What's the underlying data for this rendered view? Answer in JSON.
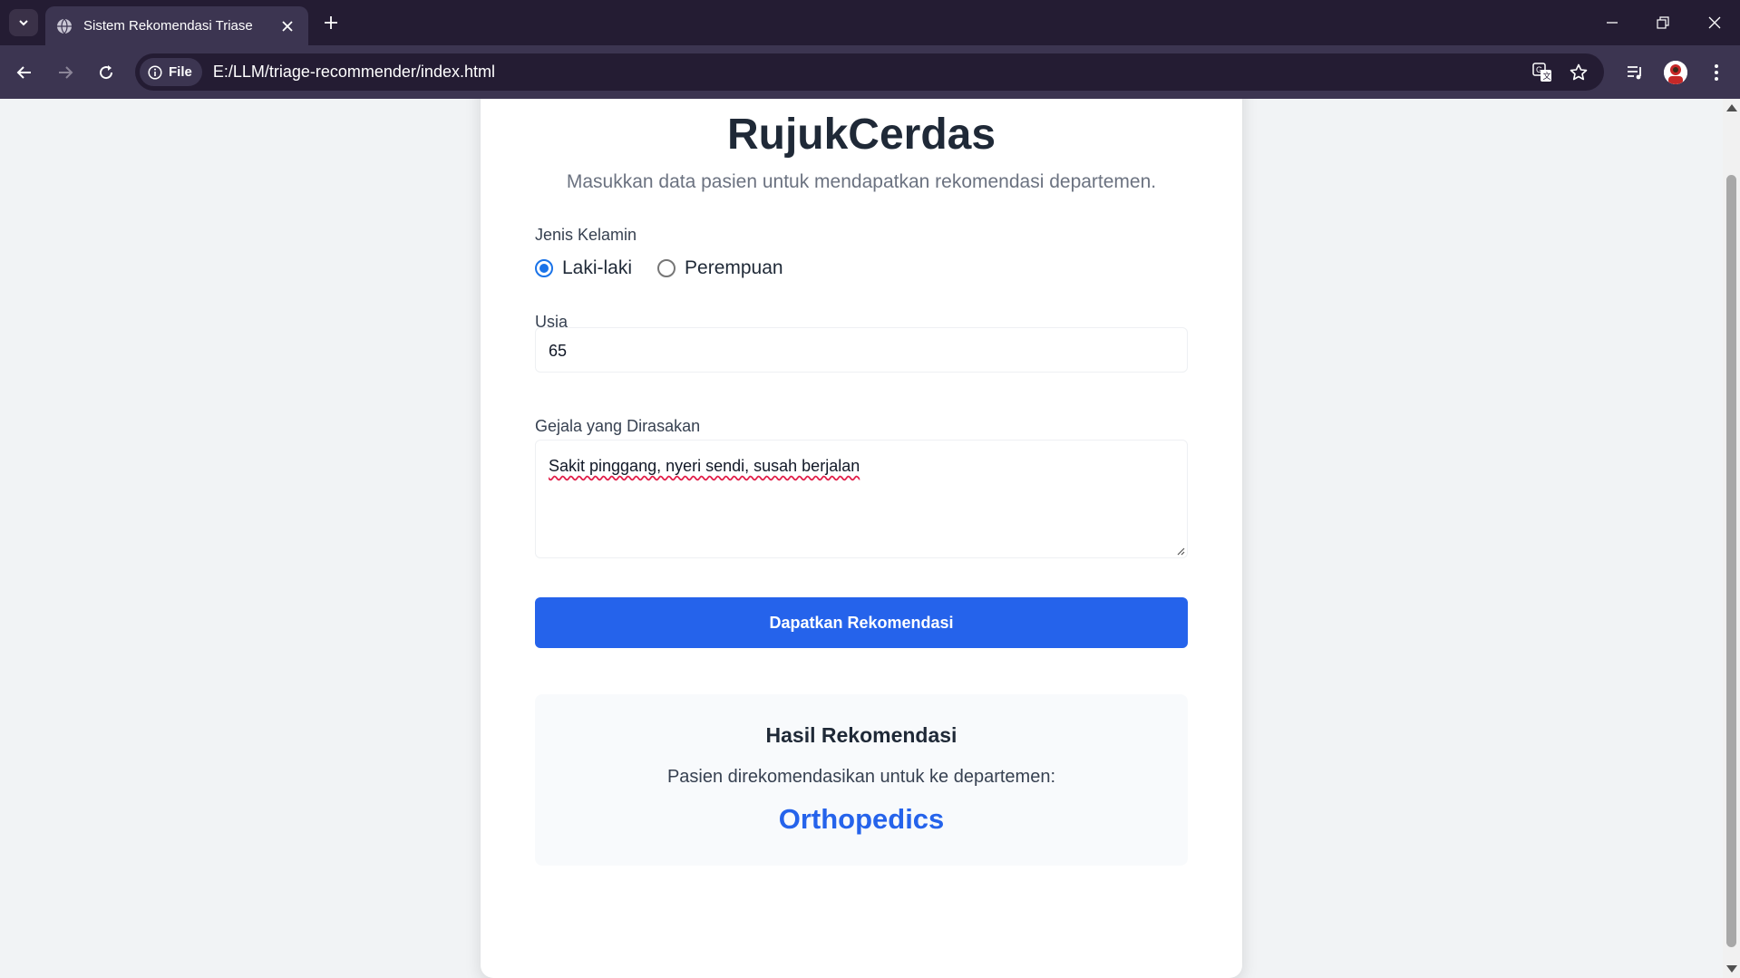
{
  "browser": {
    "tab_title": "Sistem Rekomendasi Triase",
    "site_chip": "File",
    "url": "E:/LLM/triage-recommender/index.html"
  },
  "page": {
    "title": "RujukCerdas",
    "subtitle": "Masukkan data pasien untuk mendapatkan rekomendasi departemen.",
    "gender": {
      "label": "Jenis Kelamin",
      "options": [
        "Laki-laki",
        "Perempuan"
      ],
      "selected": "Laki-laki"
    },
    "age": {
      "label": "Usia",
      "value": "65"
    },
    "symptoms": {
      "label": "Gejala yang Dirasakan",
      "value": "Sakit pinggang, nyeri sendi, susah berjalan"
    },
    "submit_label": "Dapatkan Rekomendasi",
    "result": {
      "title": "Hasil Rekomendasi",
      "description": "Pasien direkomendasikan untuk ke departemen:",
      "department": "Orthopedics"
    }
  },
  "colors": {
    "accent": "#2563eb",
    "chrome_dark": "#241c33",
    "chrome_toolbar": "#3c3551"
  }
}
